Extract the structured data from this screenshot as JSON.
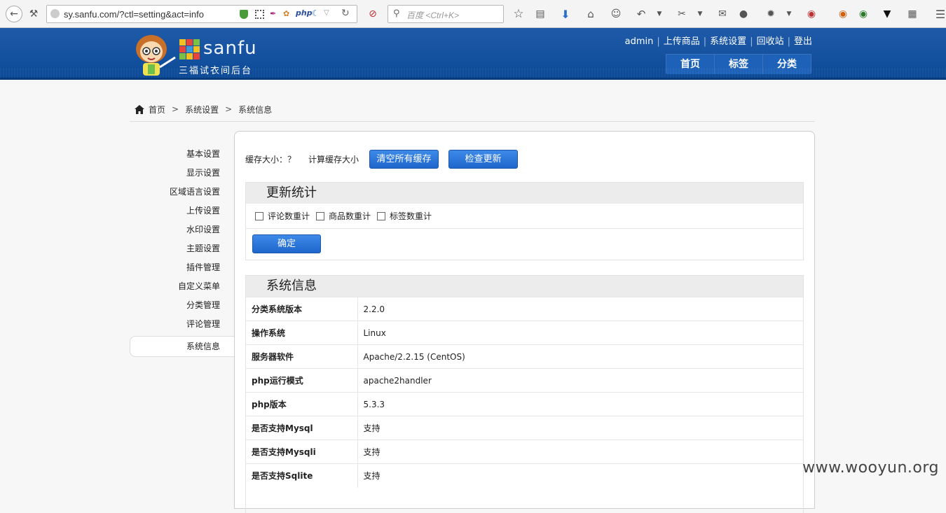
{
  "browser": {
    "url": "sy.sanfu.com/?ctl=setting&act=info",
    "search_placeholder": "百度 <Ctrl+K>"
  },
  "header": {
    "brand": "sanfu",
    "subtitle": "三福试衣间后台",
    "top_links": [
      "admin",
      "上传商品",
      "系统设置",
      "回收站",
      "登出"
    ],
    "nav": [
      "首页",
      "标签",
      "分类"
    ]
  },
  "breadcrumb": {
    "home": "首页",
    "level1": "系统设置",
    "level2": "系统信息",
    "sep": ">"
  },
  "sidebar": {
    "items": [
      "基本设置",
      "显示设置",
      "区域语言设置",
      "上传设置",
      "水印设置",
      "主题设置",
      "插件管理",
      "自定义菜单",
      "分类管理",
      "评论管理"
    ],
    "active": "系统信息"
  },
  "cache": {
    "size_label": "缓存大小：？",
    "calc_label": "计算缓存大小",
    "clear_button": "清空所有缓存",
    "update_button": "检查更新"
  },
  "update_stats": {
    "title": "更新统计",
    "options": [
      "评论数重计",
      "商品数重计",
      "标签数重计"
    ],
    "confirm": "确定"
  },
  "system_info": {
    "title": "系统信息",
    "rows": [
      {
        "k": "分类系统版本",
        "v": "2.2.0"
      },
      {
        "k": "操作系统",
        "v": "Linux"
      },
      {
        "k": "服务器软件",
        "v": "Apache/2.2.15 (CentOS)"
      },
      {
        "k": "php运行模式",
        "v": "apache2handler"
      },
      {
        "k": "php版本",
        "v": "5.3.3"
      },
      {
        "k": "是否支持Mysql",
        "v": "支持"
      },
      {
        "k": "是否支持Mysqli",
        "v": "支持"
      },
      {
        "k": "是否支持Sqlite",
        "v": "支持"
      }
    ]
  },
  "watermark": "www.wooyun.org"
}
